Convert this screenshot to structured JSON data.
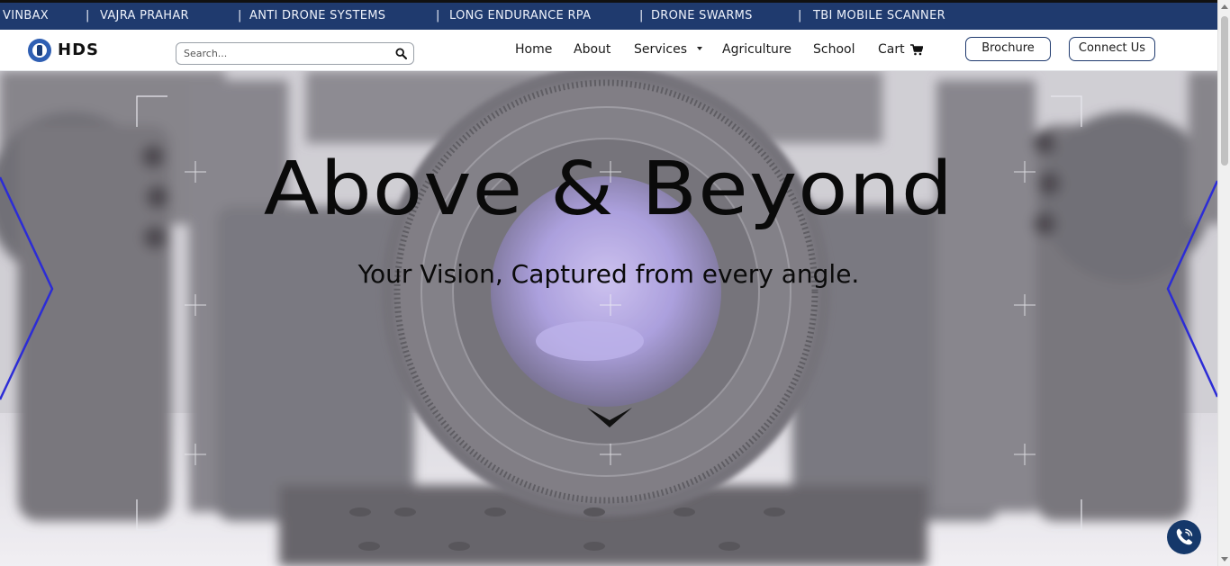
{
  "ticker": {
    "items": [
      "VINBAX",
      "VAJRA PRAHAR",
      "ANTI DRONE SYSTEMS",
      "LONG ENDURANCE RPA",
      "DRONE SWARMS",
      "TBI MOBILE SCANNER"
    ],
    "separator": "|"
  },
  "header": {
    "logo_text": "HDS",
    "search": {
      "placeholder": "Search...",
      "value": ""
    },
    "nav": {
      "home": "Home",
      "about": "About",
      "services": "Services",
      "agriculture": "Agriculture",
      "school": "School",
      "cart": "Cart"
    },
    "brochure_label": "Brochure",
    "connect_label": "Connect Us"
  },
  "hero": {
    "title": "Above & Beyond",
    "subtitle": "Your Vision, Captured from every angle."
  },
  "icons": {
    "logo": "hds-logo-icon",
    "search": "search-icon",
    "services_dropdown": "caret-down-icon",
    "cart": "cart-icon",
    "scroll_down": "chevron-down-icon",
    "call": "phone-icon"
  },
  "colors": {
    "ticker_bg": "#1f3a6e",
    "brand_navy": "#15386a",
    "button_border": "#1f3a6e",
    "logo_blue": "#2f5fb3",
    "hero_accent": "#2c2cd6"
  }
}
